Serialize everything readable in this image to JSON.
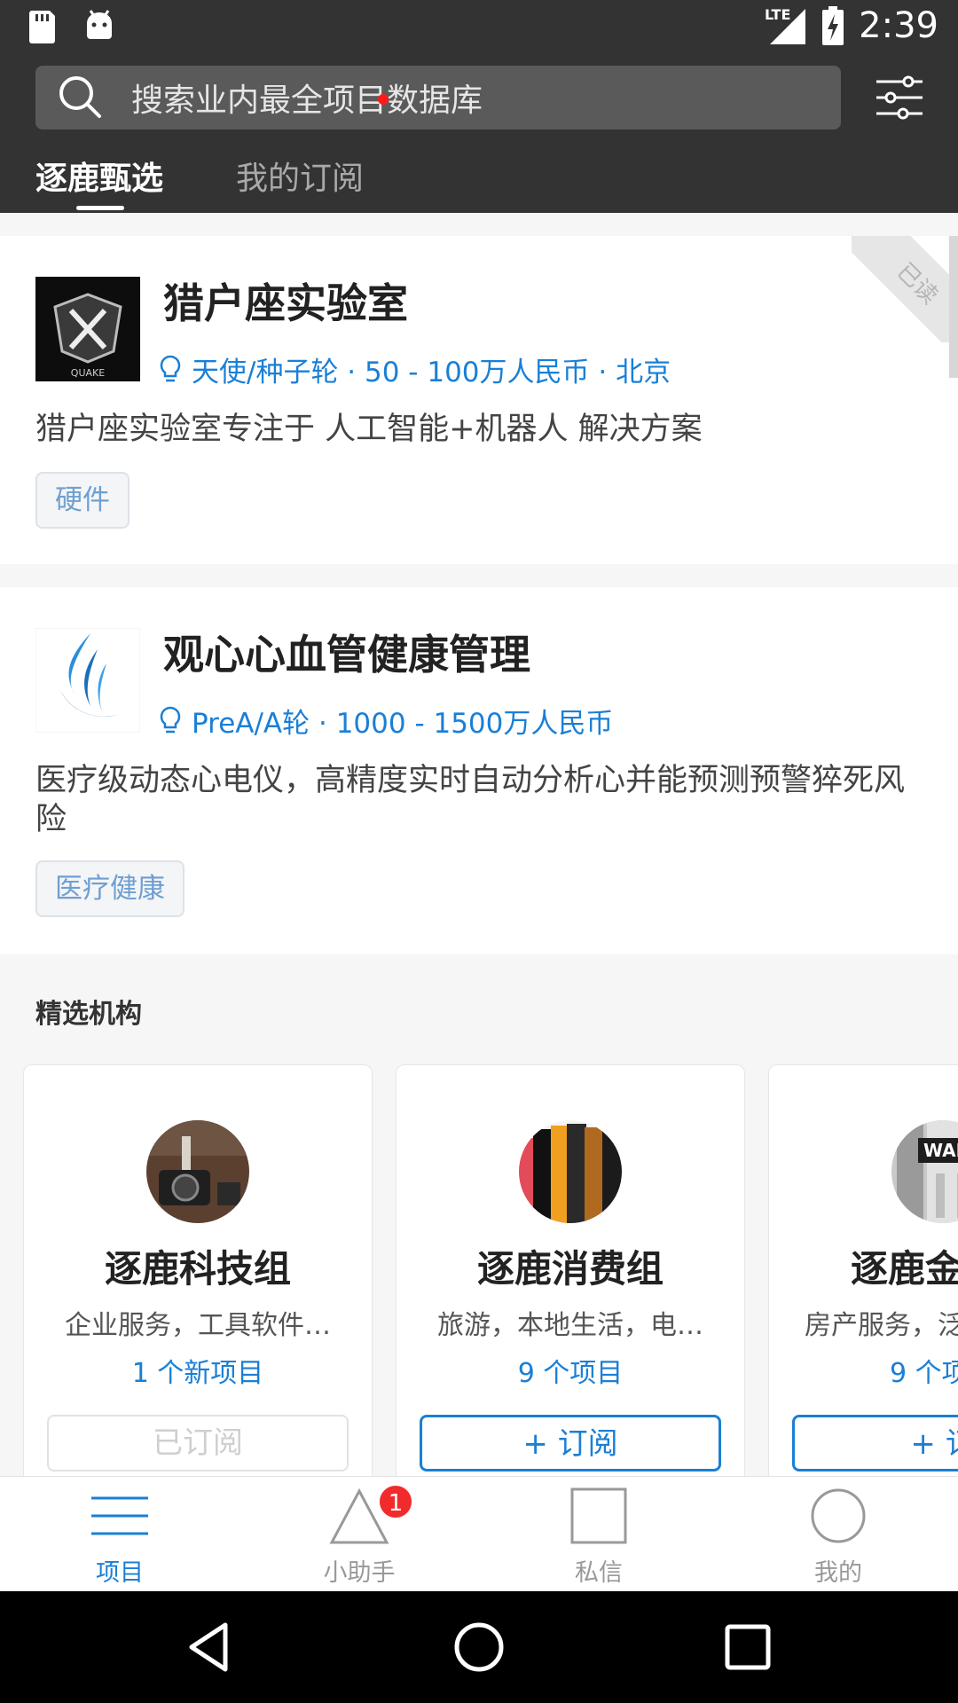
{
  "status_bar": {
    "time": "2:39",
    "network": "LTE",
    "icons": [
      "sd-card-icon",
      "android-icon",
      "signal-icon",
      "battery-charging-icon"
    ]
  },
  "search": {
    "placeholder": "搜索业内最全项目数据库"
  },
  "tabs": [
    {
      "label": "逐鹿甄选",
      "active": true
    },
    {
      "label": "我的订阅",
      "active": false,
      "has_dot": true
    }
  ],
  "projects": [
    {
      "name": "猎户座实验室",
      "logo_text": "QUAKE",
      "meta": "天使/种子轮 · 50 - 100万人民币 · 北京",
      "description": "猎户座实验室专注于 人工智能+机器人 解决方案",
      "tag": "硬件",
      "read_label": "已读"
    },
    {
      "name": "观心心血管健康管理",
      "meta": "PreA/A轮 · 1000 - 1500万人民币",
      "description": "医疗级动态心电仪，高精度实时自动分析心并能预测预警猝死风险",
      "tag": "医疗健康"
    }
  ],
  "featured": {
    "title": "精选机构",
    "orgs": [
      {
        "name": "逐鹿科技组",
        "desc": "企业服务，工具软件…",
        "projects": "1 个新项目",
        "button": "已订阅",
        "subscribed": true
      },
      {
        "name": "逐鹿消费组",
        "desc": "旅游，本地生活，电…",
        "projects": "9 个项目",
        "button": "+ 订阅",
        "subscribed": false
      },
      {
        "name": "逐鹿金",
        "desc": "房产服务，泛",
        "projects": "9 个项",
        "button": "+ 订",
        "subscribed": false
      }
    ]
  },
  "bottom_nav": [
    {
      "label": "项目",
      "icon": "list-icon",
      "active": true
    },
    {
      "label": "小助手",
      "icon": "triangle-icon",
      "badge": "1"
    },
    {
      "label": "私信",
      "icon": "square-icon"
    },
    {
      "label": "我的",
      "icon": "circle-icon"
    }
  ],
  "colors": {
    "header_bg": "#333333",
    "accent": "#1a7fd6",
    "badge": "#f12b2b"
  }
}
